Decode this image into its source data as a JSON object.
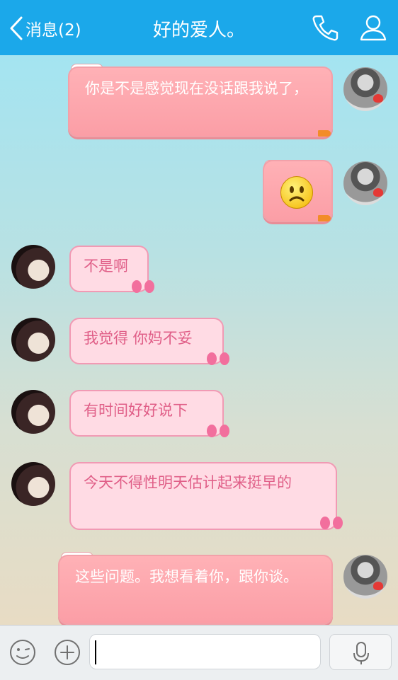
{
  "header": {
    "back_label": "消息(2)",
    "title": "好的爱人。",
    "phone_icon": "phone-icon",
    "profile_icon": "person-icon",
    "background": "#1ba8ea"
  },
  "messages": [
    {
      "from": "me",
      "text": "你是不是感觉现在没话跟我说了，"
    },
    {
      "from": "me",
      "emoji": "sad-face"
    },
    {
      "from": "her",
      "text": "不是啊"
    },
    {
      "from": "her",
      "text": "我觉得 你妈不妥"
    },
    {
      "from": "her",
      "text": "有时间好好说下"
    },
    {
      "from": "her",
      "text": "今天不得性明天估计起来挺早的"
    },
    {
      "from": "me",
      "text": "这些问题。我想看着你，跟你谈。"
    }
  ],
  "colors": {
    "out_bubble": "#fb9ea6",
    "in_bubble": "#ffdbe4",
    "in_text": "#e05f88"
  },
  "input_bar": {
    "value": "",
    "emoji_icon": "smiley-icon",
    "plus_icon": "plus-icon",
    "voice_icon": "microphone-icon"
  }
}
